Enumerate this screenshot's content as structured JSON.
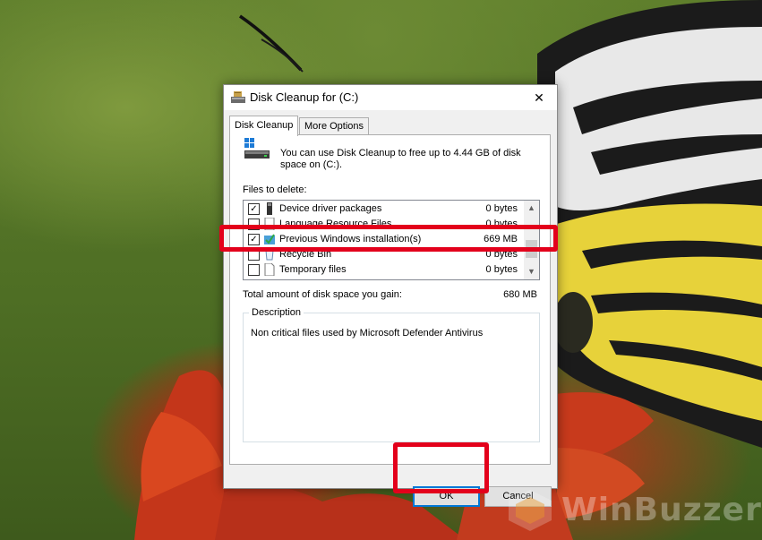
{
  "window": {
    "title": "Disk Cleanup for  (C:)",
    "close_glyph": "✕"
  },
  "tabs": [
    {
      "label": "Disk Cleanup",
      "active": true
    },
    {
      "label": "More Options",
      "active": false
    }
  ],
  "summary": {
    "text": "You can use Disk Cleanup to free up to 4.44 GB of disk space on  (C:)."
  },
  "files": {
    "label": "Files to delete:",
    "items": [
      {
        "name": "Device driver packages",
        "size": "0 bytes",
        "checked": true,
        "icon": "device-driver-icon"
      },
      {
        "name": "Language Resource Files",
        "size": "0 bytes",
        "checked": false,
        "icon": "language-file-icon"
      },
      {
        "name": "Previous Windows installation(s)",
        "size": "669 MB",
        "checked": true,
        "icon": "windows-installation-icon"
      },
      {
        "name": "Recycle Bin",
        "size": "0 bytes",
        "checked": false,
        "icon": "recycle-bin-icon"
      },
      {
        "name": "Temporary files",
        "size": "0 bytes",
        "checked": false,
        "icon": "temporary-file-icon"
      }
    ]
  },
  "total": {
    "label": "Total amount of disk space you gain:",
    "value": "680 MB"
  },
  "description": {
    "legend": "Description",
    "text": "Non critical files used by Microsoft Defender Antivirus"
  },
  "buttons": {
    "ok": "OK",
    "cancel": "Cancel"
  },
  "watermark": {
    "text": "WinBuzzer"
  },
  "colors": {
    "highlight": "#e3001b",
    "focus": "#0078d7"
  }
}
